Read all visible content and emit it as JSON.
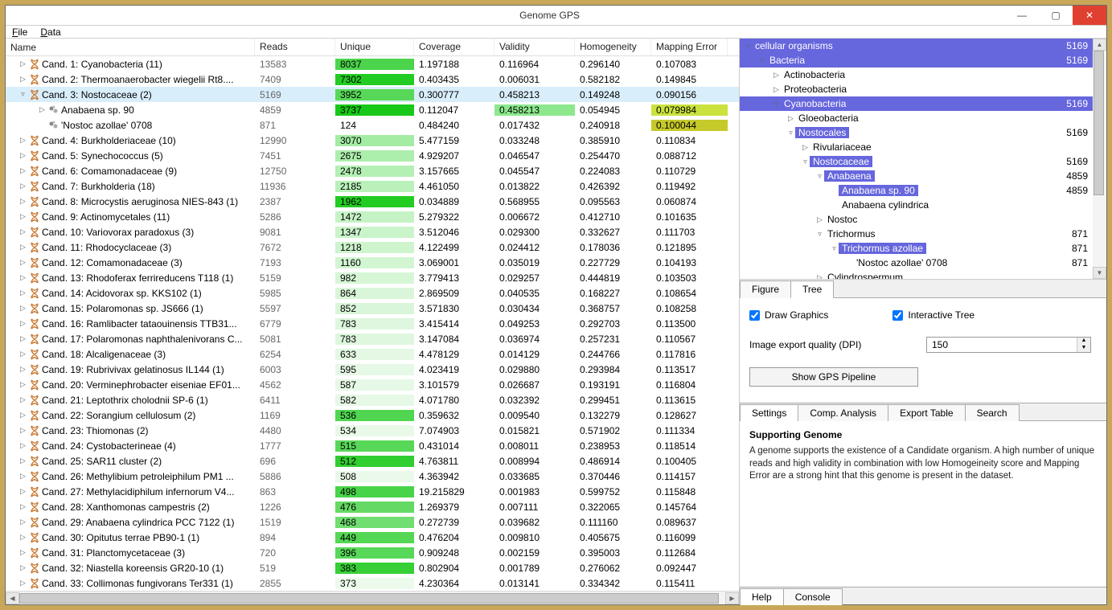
{
  "window": {
    "title": "Genome GPS"
  },
  "menu": {
    "file": "File",
    "data": "Data"
  },
  "columns": {
    "name": "Name",
    "reads": "Reads",
    "unique": "Unique",
    "coverage": "Coverage",
    "validity": "Validity",
    "homogeneity": "Homogeneity",
    "mapping": "Mapping Error"
  },
  "rows": [
    {
      "d": 0,
      "exp": "▷",
      "icon": "dna",
      "name": "Cand. 1: Cyanobacteria (11)",
      "reads": "13583",
      "uniq": "8037",
      "ucol": "#4cd44c",
      "cov": "1.197188",
      "val": "0.116964",
      "hom": "0.296140",
      "map": "0.107083"
    },
    {
      "d": 0,
      "exp": "▷",
      "icon": "dna",
      "name": "Cand. 2: Thermoanaerobacter wiegelii Rt8....",
      "reads": "7409",
      "uniq": "7302",
      "ucol": "#22cc22",
      "cov": "0.403435",
      "val": "0.006031",
      "hom": "0.582182",
      "map": "0.149845"
    },
    {
      "d": 0,
      "exp": "▿",
      "icon": "dna",
      "name": "Cand. 3: Nostocaceae (2)",
      "reads": "5169",
      "uniq": "3952",
      "ucol": "#58d858",
      "cov": "0.300777",
      "val": "0.458213",
      "hom": "0.149248",
      "map": "0.090156",
      "sel": true
    },
    {
      "d": 1,
      "exp": "▷",
      "icon": "mol",
      "name": "Anabaena sp. 90",
      "reads": "4859",
      "uniq": "3737",
      "ucol": "#18c818",
      "cov": "0.112047",
      "val": "0.458213",
      "valbg": "#8de88d",
      "hom": "0.054945",
      "map": "0.079984",
      "mapbg": "#cbe23e",
      "sub": 1
    },
    {
      "d": 1,
      "exp": "",
      "icon": "mol",
      "name": "'Nostoc azollae' 0708",
      "reads": "871",
      "uniq": "124",
      "ucol": "",
      "cov": "0.484240",
      "val": "0.017432",
      "hom": "0.240918",
      "map": "0.100044",
      "mapbg": "#c6c92a",
      "sub": 2
    },
    {
      "d": 0,
      "exp": "▷",
      "icon": "dna",
      "name": "Cand. 4: Burkholderiaceae (10)",
      "reads": "12990",
      "uniq": "3070",
      "ucol": "#a4eca4",
      "cov": "5.477159",
      "val": "0.033248",
      "hom": "0.385910",
      "map": "0.110834"
    },
    {
      "d": 0,
      "exp": "▷",
      "icon": "dna",
      "name": "Cand. 5: Synechococcus (5)",
      "reads": "7451",
      "uniq": "2675",
      "ucol": "#aceeac",
      "cov": "4.929207",
      "val": "0.046547",
      "hom": "0.254470",
      "map": "0.088712"
    },
    {
      "d": 0,
      "exp": "▷",
      "icon": "dna",
      "name": "Cand. 6: Comamonadaceae (9)",
      "reads": "12750",
      "uniq": "2478",
      "ucol": "#b4f0b4",
      "cov": "3.157665",
      "val": "0.045547",
      "hom": "0.224083",
      "map": "0.110729"
    },
    {
      "d": 0,
      "exp": "▷",
      "icon": "dna",
      "name": "Cand. 7: Burkholderia (18)",
      "reads": "11936",
      "uniq": "2185",
      "ucol": "#baf1ba",
      "cov": "4.461050",
      "val": "0.013822",
      "hom": "0.426392",
      "map": "0.119492"
    },
    {
      "d": 0,
      "exp": "▷",
      "icon": "dna",
      "name": "Cand. 8: Microcystis aeruginosa NIES-843 (1)",
      "reads": "2387",
      "uniq": "1962",
      "ucol": "#22cc22",
      "cov": "0.034889",
      "val": "0.568955",
      "hom": "0.095563",
      "map": "0.060874"
    },
    {
      "d": 0,
      "exp": "▷",
      "icon": "dna",
      "name": "Cand. 9: Actinomycetales (11)",
      "reads": "5286",
      "uniq": "1472",
      "ucol": "#c6f3c6",
      "cov": "5.279322",
      "val": "0.006672",
      "hom": "0.412710",
      "map": "0.101635"
    },
    {
      "d": 0,
      "exp": "▷",
      "icon": "dna",
      "name": "Cand. 10: Variovorax paradoxus (3)",
      "reads": "9081",
      "uniq": "1347",
      "ucol": "#caf4ca",
      "cov": "3.512046",
      "val": "0.029300",
      "hom": "0.332627",
      "map": "0.111703"
    },
    {
      "d": 0,
      "exp": "▷",
      "icon": "dna",
      "name": "Cand. 11: Rhodocyclaceae (3)",
      "reads": "7672",
      "uniq": "1218",
      "ucol": "#cef4ce",
      "cov": "4.122499",
      "val": "0.024412",
      "hom": "0.178036",
      "map": "0.121895"
    },
    {
      "d": 0,
      "exp": "▷",
      "icon": "dna",
      "name": "Cand. 12: Comamonadaceae (3)",
      "reads": "7193",
      "uniq": "1160",
      "ucol": "#d2f5d2",
      "cov": "3.069001",
      "val": "0.035019",
      "hom": "0.227729",
      "map": "0.104193"
    },
    {
      "d": 0,
      "exp": "▷",
      "icon": "dna",
      "name": "Cand. 13: Rhodoferax ferrireducens T118 (1)",
      "reads": "5159",
      "uniq": "982",
      "ucol": "#d6f6d6",
      "cov": "3.779413",
      "val": "0.029257",
      "hom": "0.444819",
      "map": "0.103503"
    },
    {
      "d": 0,
      "exp": "▷",
      "icon": "dna",
      "name": "Cand. 14: Acidovorax sp. KKS102 (1)",
      "reads": "5985",
      "uniq": "864",
      "ucol": "#daf6da",
      "cov": "2.869509",
      "val": "0.040535",
      "hom": "0.168227",
      "map": "0.108654"
    },
    {
      "d": 0,
      "exp": "▷",
      "icon": "dna",
      "name": "Cand. 15: Polaromonas sp. JS666 (1)",
      "reads": "5597",
      "uniq": "852",
      "ucol": "#daf6da",
      "cov": "3.571830",
      "val": "0.030434",
      "hom": "0.368757",
      "map": "0.108258"
    },
    {
      "d": 0,
      "exp": "▷",
      "icon": "dna",
      "name": "Cand. 16: Ramlibacter tataouinensis TTB31...",
      "reads": "6779",
      "uniq": "783",
      "ucol": "#def7de",
      "cov": "3.415414",
      "val": "0.049253",
      "hom": "0.292703",
      "map": "0.113500"
    },
    {
      "d": 0,
      "exp": "▷",
      "icon": "dna",
      "name": "Cand. 17: Polaromonas naphthalenivorans C...",
      "reads": "5081",
      "uniq": "783",
      "ucol": "#def7de",
      "cov": "3.147084",
      "val": "0.036974",
      "hom": "0.257231",
      "map": "0.110567"
    },
    {
      "d": 0,
      "exp": "▷",
      "icon": "dna",
      "name": "Cand. 18: Alcaligenaceae (3)",
      "reads": "6254",
      "uniq": "633",
      "ucol": "#e4f8e4",
      "cov": "4.478129",
      "val": "0.014129",
      "hom": "0.244766",
      "map": "0.117816"
    },
    {
      "d": 0,
      "exp": "▷",
      "icon": "dna",
      "name": "Cand. 19: Rubrivivax gelatinosus IL144 (1)",
      "reads": "6003",
      "uniq": "595",
      "ucol": "#e6f8e6",
      "cov": "4.023419",
      "val": "0.029880",
      "hom": "0.293984",
      "map": "0.113517"
    },
    {
      "d": 0,
      "exp": "▷",
      "icon": "dna",
      "name": "Cand. 20: Verminephrobacter eiseniae EF01...",
      "reads": "4562",
      "uniq": "587",
      "ucol": "#e6f8e6",
      "cov": "3.101579",
      "val": "0.026687",
      "hom": "0.193191",
      "map": "0.116804"
    },
    {
      "d": 0,
      "exp": "▷",
      "icon": "dna",
      "name": "Cand. 21: Leptothrix cholodnii SP-6 (1)",
      "reads": "6411",
      "uniq": "582",
      "ucol": "#e6f8e6",
      "cov": "4.071780",
      "val": "0.032392",
      "hom": "0.299451",
      "map": "0.113615"
    },
    {
      "d": 0,
      "exp": "▷",
      "icon": "dna",
      "name": "Cand. 22: Sorangium cellulosum (2)",
      "reads": "1169",
      "uniq": "536",
      "ucol": "#50d650",
      "cov": "0.359632",
      "val": "0.009540",
      "hom": "0.132279",
      "map": "0.128627"
    },
    {
      "d": 0,
      "exp": "▷",
      "icon": "dna",
      "name": "Cand. 23: Thiomonas (2)",
      "reads": "4480",
      "uniq": "534",
      "ucol": "#e8f9e8",
      "cov": "7.074903",
      "val": "0.015821",
      "hom": "0.571902",
      "map": "0.111334"
    },
    {
      "d": 0,
      "exp": "▷",
      "icon": "dna",
      "name": "Cand. 24: Cystobacterineae (4)",
      "reads": "1777",
      "uniq": "515",
      "ucol": "#58d858",
      "cov": "0.431014",
      "val": "0.008011",
      "hom": "0.238953",
      "map": "0.118514"
    },
    {
      "d": 0,
      "exp": "▷",
      "icon": "dna",
      "name": "Cand. 25: SAR11 cluster (2)",
      "reads": "696",
      "uniq": "512",
      "ucol": "#30ce30",
      "cov": "4.763811",
      "val": "0.008994",
      "hom": "0.486914",
      "map": "0.100405"
    },
    {
      "d": 0,
      "exp": "▷",
      "icon": "dna",
      "name": "Cand. 26: Methylibium petroleiphilum PM1 ...",
      "reads": "5886",
      "uniq": "508",
      "ucol": "#eaf9ea",
      "cov": "4.363942",
      "val": "0.033685",
      "hom": "0.370446",
      "map": "0.114157"
    },
    {
      "d": 0,
      "exp": "▷",
      "icon": "dna",
      "name": "Cand. 27: Methylacidiphilum infernorum V4...",
      "reads": "863",
      "uniq": "498",
      "ucol": "#48d448",
      "cov": "19.215829",
      "val": "0.001983",
      "hom": "0.599752",
      "map": "0.115848"
    },
    {
      "d": 0,
      "exp": "▷",
      "icon": "dna",
      "name": "Cand. 28: Xanthomonas campestris (2)",
      "reads": "1226",
      "uniq": "476",
      "ucol": "#64da64",
      "cov": "1.269379",
      "val": "0.007111",
      "hom": "0.322065",
      "map": "0.145764"
    },
    {
      "d": 0,
      "exp": "▷",
      "icon": "dna",
      "name": "Cand. 29: Anabaena cylindrica PCC 7122 (1)",
      "reads": "1519",
      "uniq": "468",
      "ucol": "#70de70",
      "cov": "0.272739",
      "val": "0.039682",
      "hom": "0.111160",
      "map": "0.089637"
    },
    {
      "d": 0,
      "exp": "▷",
      "icon": "dna",
      "name": "Cand. 30: Opitutus terrae PB90-1 (1)",
      "reads": "894",
      "uniq": "449",
      "ucol": "#54d754",
      "cov": "0.476204",
      "val": "0.009810",
      "hom": "0.405675",
      "map": "0.116099"
    },
    {
      "d": 0,
      "exp": "▷",
      "icon": "dna",
      "name": "Cand. 31: Planctomycetaceae (3)",
      "reads": "720",
      "uniq": "396",
      "ucol": "#58d858",
      "cov": "0.909248",
      "val": "0.002159",
      "hom": "0.395003",
      "map": "0.112684"
    },
    {
      "d": 0,
      "exp": "▷",
      "icon": "dna",
      "name": "Cand. 32: Niastella koreensis GR20-10 (1)",
      "reads": "519",
      "uniq": "383",
      "ucol": "#36cf36",
      "cov": "0.802904",
      "val": "0.001789",
      "hom": "0.276062",
      "map": "0.092447"
    },
    {
      "d": 0,
      "exp": "▷",
      "icon": "dna",
      "name": "Cand. 33: Collimonas fungivorans Ter331 (1)",
      "reads": "2855",
      "uniq": "373",
      "ucol": "#ecfaec",
      "cov": "4.230364",
      "val": "0.013141",
      "hom": "0.334342",
      "map": "0.115411"
    }
  ],
  "tree": [
    {
      "d": 0,
      "exp": "▿",
      "label": "cellular organisms",
      "count": "5169",
      "hl": true
    },
    {
      "d": 1,
      "exp": "▿",
      "label": "Bacteria",
      "count": "5169",
      "hl": true
    },
    {
      "d": 2,
      "exp": "▷",
      "label": "Actinobacteria",
      "count": ""
    },
    {
      "d": 2,
      "exp": "▷",
      "label": "Proteobacteria",
      "count": ""
    },
    {
      "d": 2,
      "exp": "▿",
      "label": "Cyanobacteria",
      "count": "5169",
      "hl": true
    },
    {
      "d": 3,
      "exp": "▷",
      "label": "Gloeobacteria",
      "count": ""
    },
    {
      "d": 3,
      "exp": "▿",
      "label": "Nostocales",
      "count": "5169",
      "hlp": true
    },
    {
      "d": 4,
      "exp": "▷",
      "label": "Rivulariaceae",
      "count": ""
    },
    {
      "d": 4,
      "exp": "▿",
      "label": "Nostocaceae",
      "count": "5169",
      "hlp": true
    },
    {
      "d": 5,
      "exp": "▿",
      "label": "Anabaena",
      "count": "4859",
      "hlp": true
    },
    {
      "d": 6,
      "exp": "",
      "label": "Anabaena sp. 90",
      "count": "4859",
      "hlp": true
    },
    {
      "d": 6,
      "exp": "",
      "label": "Anabaena cylindrica",
      "count": ""
    },
    {
      "d": 5,
      "exp": "▷",
      "label": "Nostoc",
      "count": ""
    },
    {
      "d": 5,
      "exp": "▿",
      "label": "Trichormus",
      "count": "871"
    },
    {
      "d": 6,
      "exp": "▿",
      "label": "Trichormus azollae",
      "count": "871",
      "hlp": true
    },
    {
      "d": 7,
      "exp": "",
      "label": "'Nostoc azollae' 0708",
      "count": "871"
    },
    {
      "d": 5,
      "exp": "▷",
      "label": "Cylindrospermum",
      "count": ""
    }
  ],
  "tabs": {
    "figure": "Figure",
    "tree": "Tree"
  },
  "controls": {
    "draw": "Draw Graphics",
    "interactive": "Interactive Tree",
    "dpi_label": "Image export quality (DPI)",
    "dpi_value": "150",
    "gps_button": "Show GPS Pipeline"
  },
  "tabs2": {
    "settings": "Settings",
    "comp": "Comp. Analysis",
    "export": "Export Table",
    "search": "Search"
  },
  "support": {
    "title": "Supporting Genome",
    "text": "A genome supports the existence of a Candidate organism. A high number of unique reads and high validity in combination with low Homogeineity score and Mapping Error are a strong hint that this genome is present in the dataset."
  },
  "bottom": {
    "help": "Help",
    "console": "Console"
  }
}
